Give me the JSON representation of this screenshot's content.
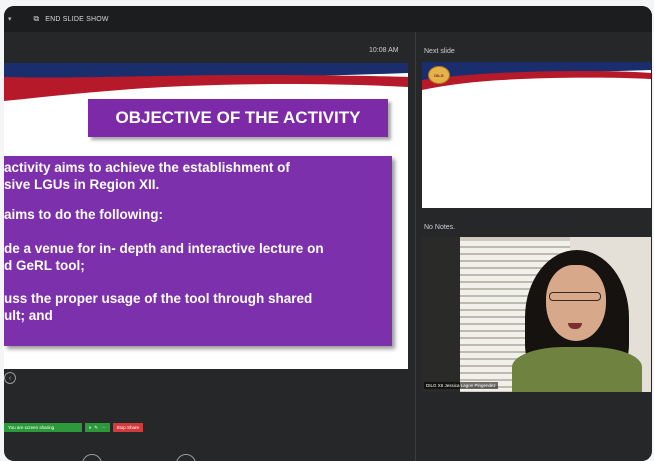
{
  "window": {
    "title": "END SLIDE SHOW",
    "caret": "▾",
    "app_icon": "slideshow-icon"
  },
  "presenter": {
    "time": "10:08 AM",
    "next_slide_label": "Next slide",
    "notes_label": "No Notes."
  },
  "slide": {
    "heading": "OBJECTIVE OF THE ACTIVITY",
    "lines": [
      " activity aims to achieve the establishment of",
      "sive LGUs in Region XII.",
      "aims to  do the following:",
      "de a venue for in- depth and interactive lecture on",
      "d GeRL tool;",
      "uss the proper usage of the tool through shared",
      "ult; and"
    ]
  },
  "next_slide": {
    "logo_text": "DILG"
  },
  "video": {
    "participant_name": "DILG XII Jessica Lagon Pingendez"
  },
  "share_bar": {
    "status_text": "You are screen sharing",
    "stop_label": "Stop Share"
  },
  "colors": {
    "purple": "#7c30ac",
    "band_red": "#b5192a",
    "band_blue": "#1a2e6e"
  }
}
